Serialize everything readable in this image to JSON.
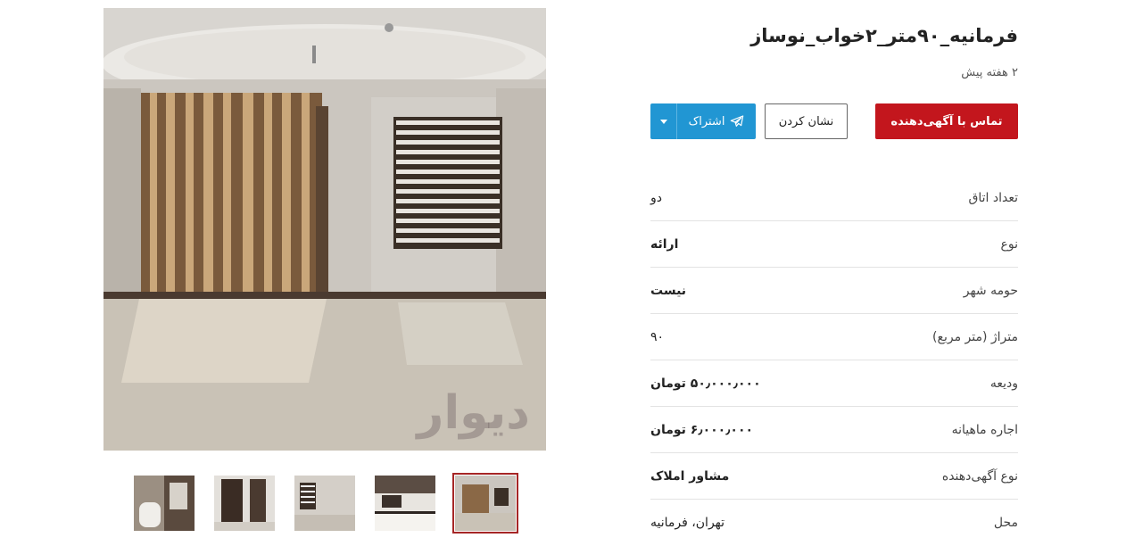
{
  "listing": {
    "title": "فرمانیه_۹۰متر_۲خواب_نوساز",
    "posted": "۲ هفته پیش",
    "watermark": "دیوار"
  },
  "actions": {
    "contact_label": "تماس با آگهی‌دهنده",
    "bookmark_label": "نشان کردن",
    "share_label": "اشتراک",
    "share_icon": "telegram-icon",
    "share_color": "#2196d3",
    "contact_color": "#c3161d"
  },
  "details": [
    {
      "label": "تعداد اتاق",
      "value": "دو"
    },
    {
      "label": "نوع",
      "value": "ارائه"
    },
    {
      "label": "حومه شهر",
      "value": "نیست"
    },
    {
      "label": "متراژ (متر مربع)",
      "value": "۹۰"
    },
    {
      "label": "ودیعه",
      "value": "۵۰٫۰۰۰٫۰۰۰ تومان"
    },
    {
      "label": "اجاره ماهیانه",
      "value": "۶٫۰۰۰٫۰۰۰ تومان"
    },
    {
      "label": "نوع آگهی‌دهنده",
      "value": "مشاور املاک"
    },
    {
      "label": "محل",
      "value": "تهران، فرمانیه"
    }
  ],
  "gallery": {
    "thumbnail_count": 5,
    "selected_index": 4
  }
}
